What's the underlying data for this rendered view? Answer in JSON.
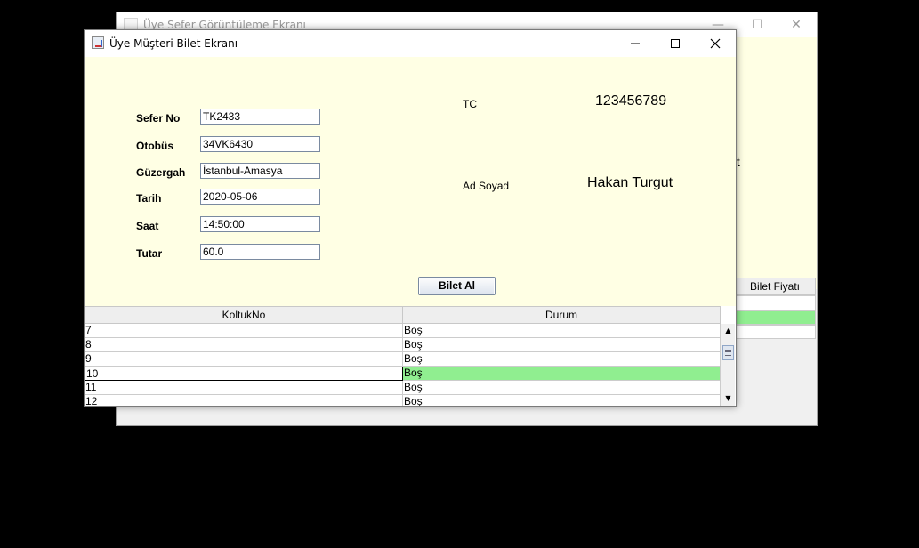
{
  "background_window": {
    "title": "Üye Sefer Görüntüleme Ekranı",
    "partial_text": "ıt",
    "table_header_partial": "Bilet Fiyatı",
    "highlight_color": "#90ee90"
  },
  "window": {
    "title": "Üye Müşteri Bilet Ekranı",
    "controls": [
      "minimize",
      "maximize",
      "close"
    ]
  },
  "form": {
    "fields": [
      {
        "label": "Sefer No",
        "value": "TK2433"
      },
      {
        "label": "Otobüs",
        "value": "34VK6430"
      },
      {
        "label": "Güzergah",
        "value": "İstanbul-Amasya"
      },
      {
        "label": "Tarih",
        "value": "2020-05-06"
      },
      {
        "label": "Saat",
        "value": "14:50:00"
      },
      {
        "label": "Tutar",
        "value": "60.0"
      }
    ]
  },
  "customer": {
    "tc_label": "TC",
    "tc_value": "123456789",
    "name_label": "Ad Soyad",
    "name_value": "Hakan Turgut"
  },
  "buy_button": "Bilet Al",
  "table": {
    "columns": [
      "KoltukNo",
      "Durum"
    ],
    "rows": [
      {
        "seat": "7",
        "status": "Boş"
      },
      {
        "seat": "8",
        "status": "Boş"
      },
      {
        "seat": "9",
        "status": "Boş"
      },
      {
        "seat": "10",
        "status": "Boş",
        "selected": true
      },
      {
        "seat": "11",
        "status": "Boş"
      },
      {
        "seat": "12",
        "status": "Boş"
      }
    ],
    "selected_color": "#90ee90"
  },
  "colors": {
    "content_bg": "#ffffe4",
    "highlight": "#90ee90"
  }
}
